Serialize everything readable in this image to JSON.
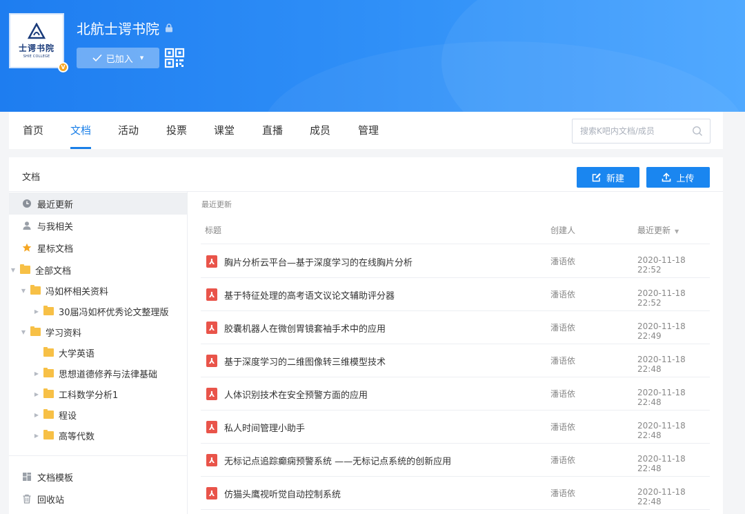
{
  "header": {
    "group_name": "北航士谔书院",
    "logo_text": "士谔书院",
    "logo_sub": "SHIE COLLEGE",
    "joined_label": "已加入",
    "verified_mark": "V",
    "brand_color": "#1e7df0"
  },
  "nav": {
    "tabs": [
      "首页",
      "文档",
      "活动",
      "投票",
      "课堂",
      "直播",
      "成员",
      "管理"
    ],
    "active_tab": "文档",
    "search_placeholder": "搜索K吧内文档/成员"
  },
  "main": {
    "title": "文档",
    "new_button": "新建",
    "upload_button": "上传"
  },
  "sidebar": {
    "top_items": [
      "最近更新",
      "与我相关",
      "星标文档"
    ],
    "active_item": "最近更新",
    "tree": [
      {
        "label": "全部文档",
        "level": 0,
        "arrow": "down"
      },
      {
        "label": "冯如杯相关资料",
        "level": 1,
        "arrow": "down"
      },
      {
        "label": "30届冯如杯优秀论文整理版",
        "level": 2,
        "arrow": "right"
      },
      {
        "label": "学习资料",
        "level": 1,
        "arrow": "down"
      },
      {
        "label": "大学英语",
        "level": 2,
        "arrow": "none"
      },
      {
        "label": "思想道德修养与法律基础",
        "level": 2,
        "arrow": "right"
      },
      {
        "label": "工科数学分析1",
        "level": 2,
        "arrow": "right"
      },
      {
        "label": "程设",
        "level": 2,
        "arrow": "right"
      },
      {
        "label": "高等代数",
        "level": 2,
        "arrow": "right"
      }
    ],
    "bottom_items": [
      "文档模板",
      "回收站"
    ]
  },
  "list": {
    "caption": "最近更新",
    "col_title": "标题",
    "col_author": "创建人",
    "col_date": "最近更新",
    "file_icon": "pdf-icon",
    "rows": [
      {
        "title": "胸片分析云平台—基于深度学习的在线胸片分析",
        "author": "潘语依",
        "date": "2020-11-18 22:52"
      },
      {
        "title": "基于特征处理的高考语文议论文辅助评分器",
        "author": "潘语依",
        "date": "2020-11-18 22:52"
      },
      {
        "title": "胶囊机器人在微创胃镜套袖手术中的应用",
        "author": "潘语依",
        "date": "2020-11-18 22:49"
      },
      {
        "title": "基于深度学习的二维图像转三维模型技术",
        "author": "潘语依",
        "date": "2020-11-18 22:48"
      },
      {
        "title": "人体识别技术在安全预警方面的应用",
        "author": "潘语依",
        "date": "2020-11-18 22:48"
      },
      {
        "title": "私人时间管理小助手",
        "author": "潘语依",
        "date": "2020-11-18 22:48"
      },
      {
        "title": "无标记点追踪癫痫预警系统 ——无标记点系统的创新应用",
        "author": "潘语依",
        "date": "2020-11-18 22:48"
      },
      {
        "title": "仿猫头鹰视听觉自动控制系统",
        "author": "潘语依",
        "date": "2020-11-18 22:48"
      }
    ]
  }
}
